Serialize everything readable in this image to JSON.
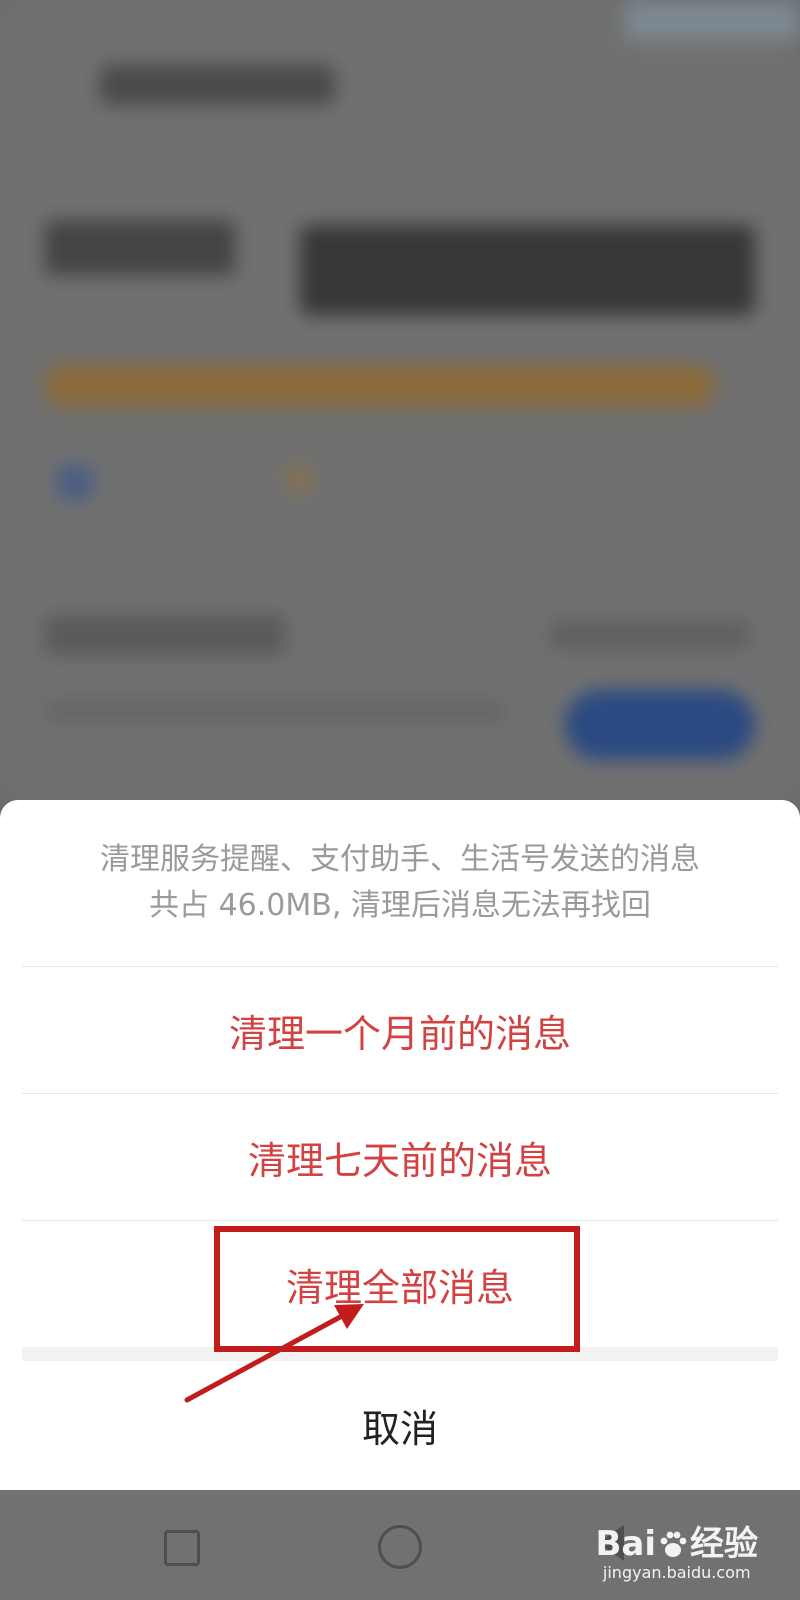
{
  "sheet": {
    "description_line1": "清理服务提醒、支付助手、生活号发送的消息",
    "description_line2": "共占 46.0MB, 清理后消息无法再找回",
    "options": [
      {
        "label": "清理一个月前的消息"
      },
      {
        "label": "清理七天前的消息"
      },
      {
        "label": "清理全部消息"
      }
    ],
    "cancel_label": "取消",
    "option_color": "#d34242"
  },
  "annotation": {
    "highlighted_option": "清理全部消息",
    "color": "#c21c1c"
  },
  "navbar": {
    "icons": [
      "recent-apps-icon",
      "home-icon",
      "back-icon"
    ]
  },
  "watermark": {
    "brand_prefix": "Bai",
    "brand_suffix": "经验",
    "url": "jingyan.baidu.com"
  }
}
